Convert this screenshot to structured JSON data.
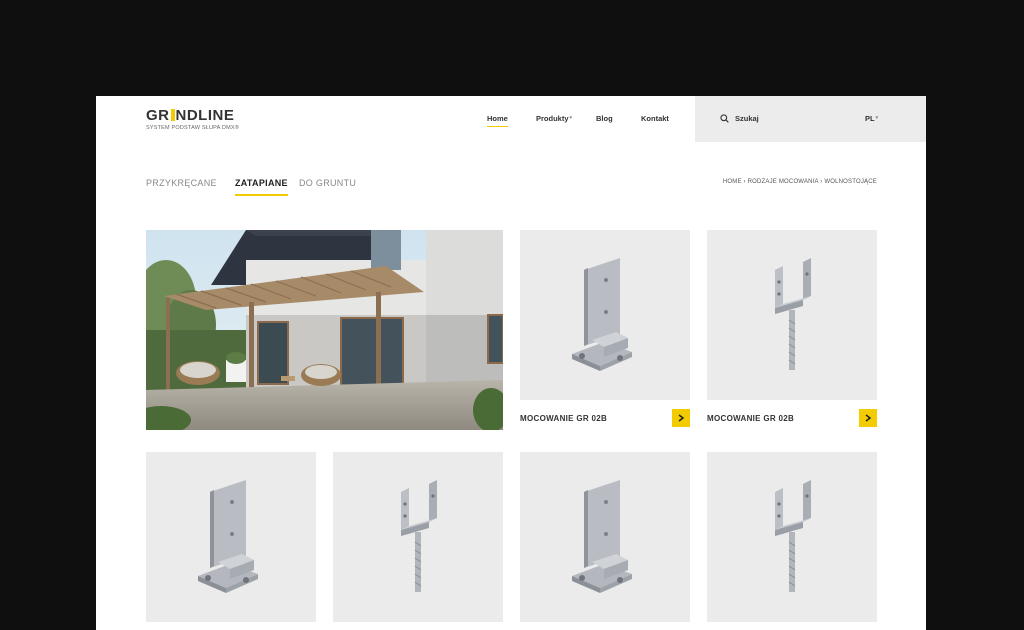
{
  "header": {
    "logo_text_a": "GR",
    "logo_text_b": "NDLINE",
    "logo_sub": "SYSTEM PODSTAW SŁUPA DMX®",
    "nav": [
      {
        "label": "Home"
      },
      {
        "label": "Produkty"
      },
      {
        "label": "Blog"
      },
      {
        "label": "Kontakt"
      }
    ],
    "search_label": "Szukaj",
    "lang": "PL"
  },
  "categories": [
    "PRZYKRĘCANE",
    "ZATAPIANE",
    "DO GRUNTU"
  ],
  "breadcrumb": "HOME › RODZAJE MOCOWANIA › WOLNOSTOJĄCE",
  "products": [
    {
      "title": "MOCOWANIE GR 02B",
      "type": "plate"
    },
    {
      "title": "MOCOWANIE GR 02B",
      "type": "fork"
    },
    {
      "title": "",
      "type": "plate"
    },
    {
      "title": "",
      "type": "fork"
    },
    {
      "title": "",
      "type": "plate"
    },
    {
      "title": "",
      "type": "fork"
    }
  ],
  "colors": {
    "accent": "#f2cc00",
    "background": "#0f0f0f",
    "tile": "#ebebeb"
  }
}
